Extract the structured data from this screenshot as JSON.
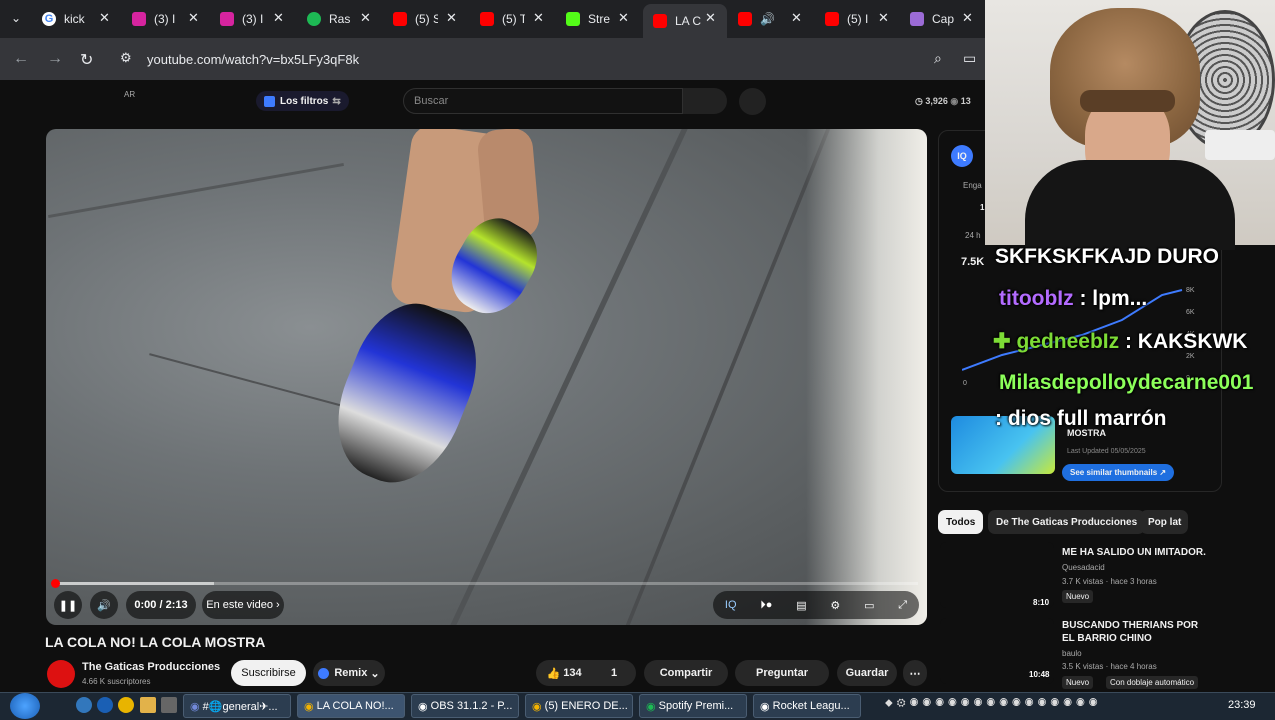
{
  "browser": {
    "tabs": [
      {
        "label": "kick",
        "color": "#4285f4"
      },
      {
        "label": "(3) I",
        "color": "#d6249f"
      },
      {
        "label": "(3) I",
        "color": "#d6249f"
      },
      {
        "label": "Ras",
        "color": "#1db954"
      },
      {
        "label": "(5) S",
        "color": "#ff0000"
      },
      {
        "label": "(5) T",
        "color": "#ff0000"
      },
      {
        "label": "Stre",
        "color": "#53fc18"
      },
      {
        "label": "LA C",
        "color": "#ff0000"
      },
      {
        "label": "",
        "color": "#ff0000"
      },
      {
        "label": "(5) I",
        "color": "#ff0000"
      },
      {
        "label": "Cap",
        "color": "#9b6bd6"
      }
    ],
    "url": "youtube.com/watch?v=bx5LFy3qF8k"
  },
  "topbar": {
    "country": "AR",
    "filters_label": "Los filtros",
    "search_placeholder": "Buscar",
    "stat1": "3,926",
    "stat2": "13"
  },
  "player": {
    "time": "0:00 / 2:13",
    "chapter": "En este video",
    "progress_fraction": 0.0
  },
  "video": {
    "title": "LA COLA NO! LA COLA MOSTRA",
    "channel": "The Gaticas Producciones",
    "subs": "4.66 K suscriptores",
    "subscribe": "Suscribirse",
    "remix": "Remix",
    "likes": "134",
    "dislikes": "1",
    "share": "Compartir",
    "ask": "Preguntar",
    "save": "Guardar"
  },
  "panel": {
    "engage": "Enga",
    "value1": "1",
    "period": "24 h",
    "views": "7.5K",
    "axis": [
      "8K",
      "6K",
      "4K",
      "2K",
      "0"
    ],
    "zero": "0",
    "thumb_title": "MOSTRA",
    "updated": "Last Updated 05/05/2025",
    "similar": "See similar thumbnails"
  },
  "chips": [
    "Todos",
    "De The Gaticas Producciones",
    "Pop lat"
  ],
  "recs": [
    {
      "title": "ME HA SALIDO UN IMITADOR.",
      "channel": "Quesadacid",
      "meta": "3.7 K vistas · hace 3 horas",
      "badge": "Nuevo",
      "duration": "8:10"
    },
    {
      "title": "BUSCANDO THERIANS POR EL BARRIO CHINO",
      "channel": "baulo",
      "meta": "3.5 K vistas · hace 4 horas",
      "badge": "Nuevo",
      "badge2": "Con doblaje automático",
      "duration": "10:48"
    }
  ],
  "chat": [
    {
      "user": "",
      "msg": "SKFKSKFKAJD DURO",
      "color": "#ffffff"
    },
    {
      "user": "titoobIz",
      "msg": ": lpm...",
      "color": "#b36bff"
    },
    {
      "user": "gedneebIz",
      "msg": ": KAKSKWK",
      "color": "#7ddc36"
    },
    {
      "user": "Milasdepolloydecarne001",
      "msg": "",
      "color": "#8cff5a"
    },
    {
      "user": "",
      "msg": ": dios full marrón",
      "color": "#ffffff"
    }
  ],
  "taskbar": {
    "items": [
      "#🌐general✈...",
      "LA COLA NO!...",
      "OBS 31.1.2 - P...",
      "(5) ENERO DE...",
      "Spotify Premi...",
      "Rocket Leagu..."
    ],
    "clock": "23:39"
  }
}
